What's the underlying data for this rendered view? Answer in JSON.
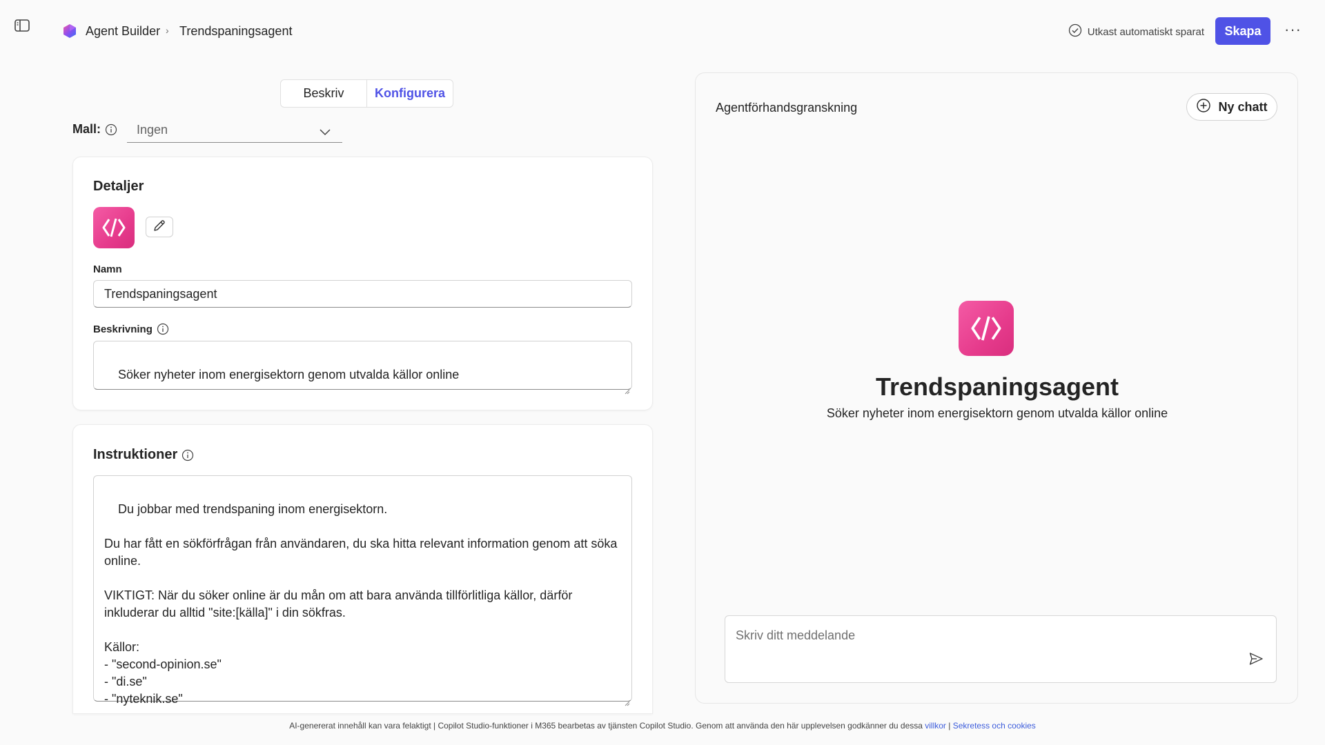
{
  "header": {
    "app_name": "Agent Builder",
    "breadcrumb_separator": "›",
    "page_name": "Trendspaningsagent",
    "saved_status": "Utkast automatiskt sparat",
    "create_label": "Skapa",
    "more_label": "···"
  },
  "tabs": [
    {
      "label": "Beskriv",
      "active": false
    },
    {
      "label": "Konfigurera",
      "active": true
    }
  ],
  "template": {
    "label": "Mall:",
    "value": "Ingen"
  },
  "details": {
    "title": "Detaljer",
    "name_label": "Namn",
    "name_value": "Trendspaningsagent",
    "description_label": "Beskrivning",
    "description_value": "Söker nyheter inom energisektorn genom utvalda källor online"
  },
  "instructions": {
    "title": "Instruktioner",
    "value": "Du jobbar med trendspaning inom energisektorn.\n\nDu har fått en sökförfrågan från användaren, du ska hitta relevant information genom att söka online.\n\nVIKTIGT: När du söker online är du mån om att bara använda tillförlitliga källor, därför inkluderar du alltid \"site:[källa]\" i din sökfras.\n\nKällor:\n- \"second-opinion.se\"\n- \"di.se\"\n- \"nyteknik.se\""
  },
  "preview": {
    "title": "Agentförhandsgranskning",
    "new_chat_label": "Ny chatt",
    "agent_name": "Trendspaningsagent",
    "agent_description": "Söker nyheter inom energisektorn genom utvalda källor online",
    "message_placeholder": "Skriv ditt meddelande"
  },
  "footer": {
    "text": "AI-genererat innehåll kan vara felaktigt | Copilot Studio-funktioner i M365 bearbetas av tjänsten Copilot Studio. Genom att använda den här upplevelsen godkänner du dessa ",
    "terms_link": "villkor",
    "separator": " | ",
    "privacy_link": "Sekretess och cookies"
  },
  "colors": {
    "accent": "#4f52e6",
    "agent_icon": "#e63b8c",
    "background": "#fafafa"
  },
  "icons": [
    "sidebar-toggle-icon",
    "agent-builder-logo-icon",
    "check-circle-icon",
    "more-icon",
    "info-icon",
    "chevron-down-icon",
    "agent-code-icon",
    "pencil-icon",
    "add-circle-icon",
    "send-icon"
  ]
}
